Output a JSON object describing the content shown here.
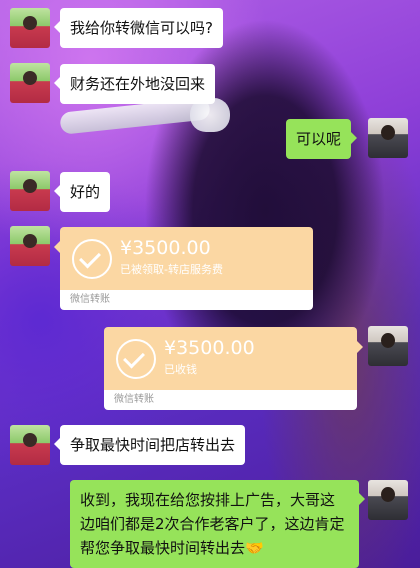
{
  "messages": [
    {
      "id": "m1",
      "side": "left",
      "text": "我给你转微信可以吗?"
    },
    {
      "id": "m2",
      "side": "left",
      "text": "财务还在外地没回来"
    },
    {
      "id": "m3",
      "side": "right",
      "text": "可以呢"
    },
    {
      "id": "m4",
      "side": "left",
      "text": "好的"
    },
    {
      "id": "m7",
      "side": "left",
      "text": "争取最快时间把店转出去"
    },
    {
      "id": "m8",
      "side": "right",
      "text": "收到，我现在给您按排上广告，大哥这边咱们都是2次合作老客户了，这边肯定帮您争取最快时间转出去🤝"
    }
  ],
  "transfers": [
    {
      "id": "t1",
      "side": "left",
      "amount": "¥3500.00",
      "status": "已被领取-转店服务费",
      "footer": "微信转账"
    },
    {
      "id": "t2",
      "side": "right",
      "amount": "¥3500.00",
      "status": "已收钱",
      "footer": "微信转账"
    }
  ],
  "colors": {
    "green_bubble": "#96e35a",
    "transfer_top": "#fbd7a3",
    "bubble_white": "#ffffff"
  },
  "icons": {
    "avatar_left": "avatar-person-on-grass",
    "avatar_right": "avatar-person-portrait",
    "transfer": "check-circle-icon"
  }
}
